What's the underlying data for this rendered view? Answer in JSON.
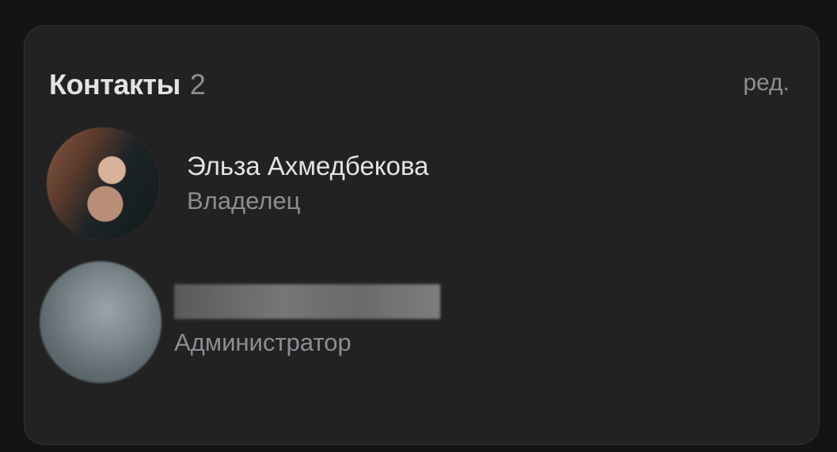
{
  "contacts_card": {
    "title": "Контакты",
    "count": "2",
    "edit_label": "ред."
  },
  "contacts": [
    {
      "name": "Эльза Ахмедбекова",
      "role": "Владелец",
      "avatar": "person-photo"
    },
    {
      "name": "",
      "role": "Администратор",
      "avatar": "blurred-photo"
    }
  ]
}
